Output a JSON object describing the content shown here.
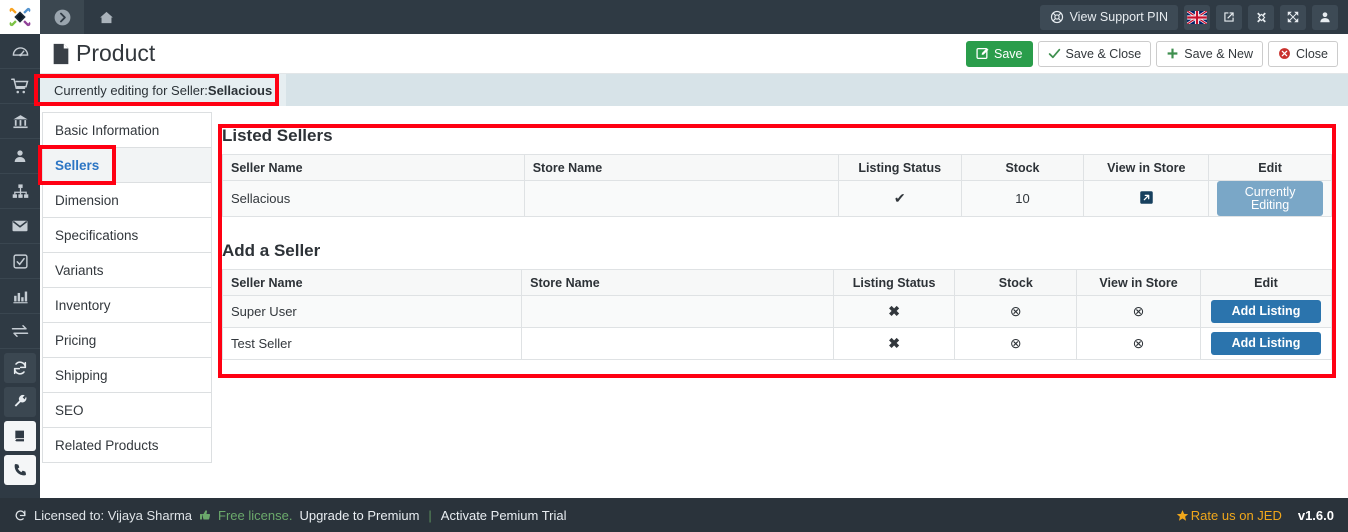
{
  "topbar": {
    "logo_icon": "joomla-logo-icon",
    "forward_icon": "arrow-circle-right-icon",
    "home_icon": "home-icon",
    "support_pin_label": "View Support PIN",
    "support_pin_icon": "lifebuoy-icon",
    "flag_icon": "uk-flag-icon",
    "external_icon": "external-link-icon",
    "joomla_icon": "joomla-mark-icon",
    "expand_icon": "expand-arrows-icon",
    "user_icon": "user-icon"
  },
  "rail": {
    "items": [
      {
        "name": "dashboard",
        "icon": "dashboard-gauge-icon"
      },
      {
        "name": "orders",
        "icon": "shopping-cart-icon"
      },
      {
        "name": "bank",
        "icon": "bank-icon"
      },
      {
        "name": "users",
        "icon": "user-icon"
      },
      {
        "name": "categories",
        "icon": "sitemap-icon"
      },
      {
        "name": "mail",
        "icon": "envelope-icon"
      },
      {
        "name": "tasks",
        "icon": "check-square-icon"
      },
      {
        "name": "reports",
        "icon": "bar-chart-icon"
      },
      {
        "name": "transfer",
        "icon": "exchange-arrows-icon"
      },
      {
        "name": "sync",
        "icon": "refresh-icon"
      },
      {
        "name": "tools",
        "icon": "wrench-icon"
      },
      {
        "name": "docs",
        "icon": "book-icon"
      },
      {
        "name": "support-call",
        "icon": "phone-icon"
      }
    ]
  },
  "page": {
    "title": "Product",
    "title_icon": "file-icon",
    "buttons": [
      {
        "label": "Save",
        "icon": "save-pencil-icon",
        "style": "green"
      },
      {
        "label": "Save & Close",
        "icon": "check-icon",
        "style": "plain"
      },
      {
        "label": "Save & New",
        "icon": "plus-icon",
        "style": "plain"
      },
      {
        "label": "Close",
        "icon": "close-circle-icon",
        "style": "plain"
      }
    ]
  },
  "infobar": {
    "prefix": "Currently editing for Seller: ",
    "seller": "Sellacious"
  },
  "tabs": [
    {
      "label": "Basic Information",
      "active": false
    },
    {
      "label": "Sellers",
      "active": true
    },
    {
      "label": "Dimension",
      "active": false
    },
    {
      "label": "Specifications",
      "active": false
    },
    {
      "label": "Variants",
      "active": false
    },
    {
      "label": "Inventory",
      "active": false
    },
    {
      "label": "Pricing",
      "active": false
    },
    {
      "label": "Shipping",
      "active": false
    },
    {
      "label": "SEO",
      "active": false
    },
    {
      "label": "Related Products",
      "active": false
    }
  ],
  "listed_sellers": {
    "title": "Listed Sellers",
    "columns": [
      "Seller Name",
      "Store Name",
      "Listing Status",
      "Stock",
      "View in Store",
      "Edit"
    ],
    "rows": [
      {
        "seller_name": "Sellacious",
        "store_name": "",
        "listing_status": "✔",
        "stock": "10",
        "view_in_store": "↗",
        "edit_label": "Currently Editing"
      }
    ]
  },
  "add_a_seller": {
    "title": "Add a Seller",
    "columns": [
      "Seller Name",
      "Store Name",
      "Listing Status",
      "Stock",
      "View in Store",
      "Edit"
    ],
    "rows": [
      {
        "seller_name": "Super User",
        "store_name": "",
        "listing_status": "✖",
        "stock": "⊗",
        "view_in_store": "⊗",
        "edit_label": "Add Listing"
      },
      {
        "seller_name": "Test Seller",
        "store_name": "",
        "listing_status": "✖",
        "stock": "⊗",
        "view_in_store": "⊗",
        "edit_label": "Add Listing"
      }
    ]
  },
  "footer": {
    "refresh_icon": "refresh-icon",
    "licensed_to": "Licensed to: Vijaya Sharma",
    "thumb_icon": "thumbs-up-icon",
    "free_license": "Free license.",
    "upgrade_label": "Upgrade to Premium",
    "separator": "|",
    "trial_label": "Activate Pemium Trial",
    "star_icon": "star-icon",
    "rate_label": "Rate us on JED",
    "version": "v1.6.0"
  },
  "colors": {
    "accent_blue": "#2b74ad",
    "muted_blue": "#7aa7c7",
    "green": "#2a9d4b",
    "dark": "#2f3a44",
    "annotation_red": "#ff0012",
    "info_bg": "#d7e3e8"
  }
}
